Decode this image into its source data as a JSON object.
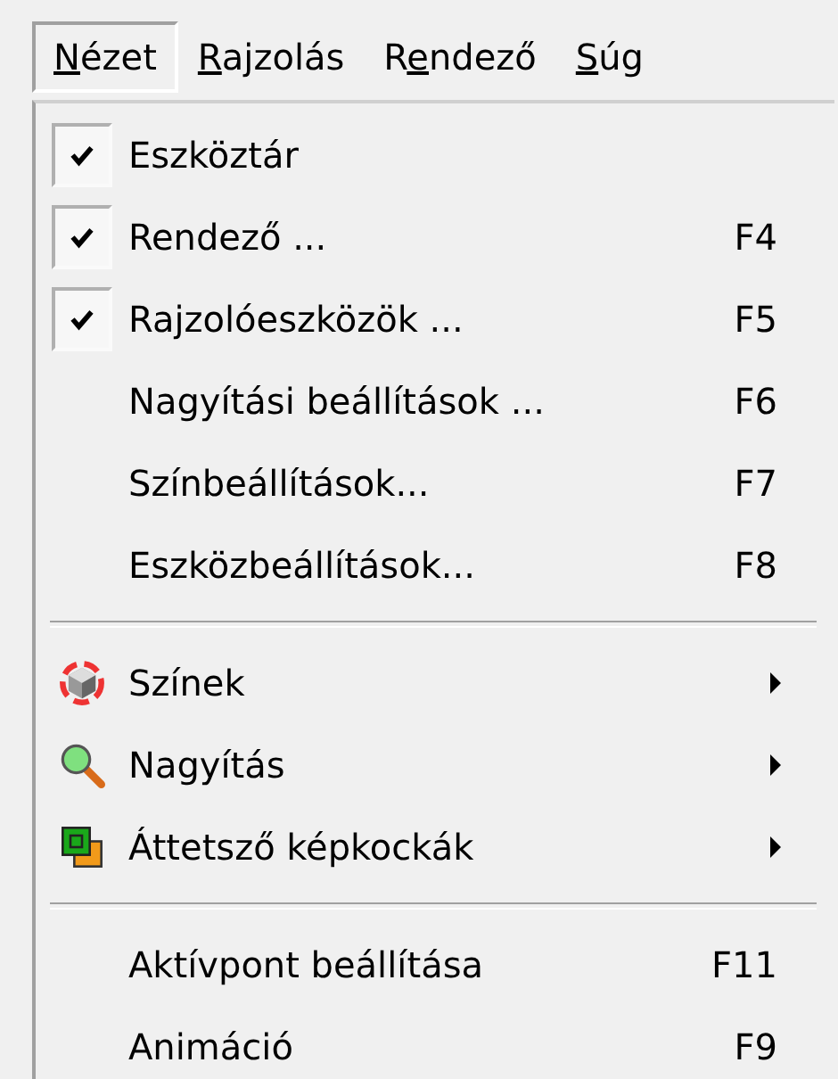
{
  "menu_bar": [
    {
      "key": "N",
      "after": "ézet",
      "selected": true
    },
    {
      "key": "R",
      "after": "ajzolás",
      "selected": false
    },
    {
      "before": "R",
      "key": "e",
      "after": "ndező",
      "selected": false
    },
    {
      "key": "S",
      "after": "úg",
      "selected": false
    }
  ],
  "menu": [
    {
      "kind": "text",
      "label": "Eszköztár",
      "checked": true
    },
    {
      "kind": "text",
      "label": "Rendező ...",
      "shortcut": "F4",
      "checked": true
    },
    {
      "kind": "text",
      "label": "Rajzolóeszközök ...",
      "shortcut": "F5",
      "checked": true
    },
    {
      "kind": "text",
      "label": "Nagyítási beállítások ...",
      "shortcut": "F6",
      "checked": false
    },
    {
      "kind": "text",
      "label": "Színbeállítások...",
      "shortcut": "F7",
      "checked": false
    },
    {
      "kind": "text",
      "label": "Eszközbeállítások...",
      "shortcut": "F8",
      "checked": false
    },
    {
      "kind": "separator"
    },
    {
      "kind": "cube",
      "label": "Színek",
      "submenu": true,
      "checked": false
    },
    {
      "kind": "magnifier",
      "label": "Nagyítás",
      "submenu": true,
      "checked": false
    },
    {
      "kind": "frames",
      "label": "Áttetsző képkockák",
      "submenu": true,
      "checked": false
    },
    {
      "kind": "separator"
    },
    {
      "kind": "text",
      "label": "Aktívpont beállítása",
      "shortcut": "F11",
      "checked": false
    },
    {
      "kind": "text",
      "label": "Animáció",
      "shortcut": "F9",
      "checked": false
    }
  ]
}
